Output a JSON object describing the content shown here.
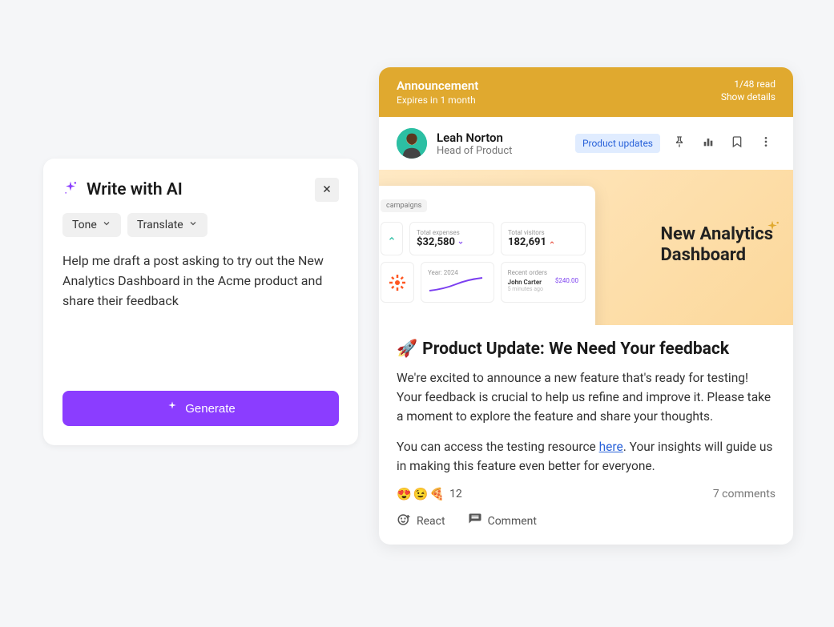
{
  "ai_panel": {
    "title": "Write with AI",
    "tone_label": "Tone",
    "translate_label": "Translate",
    "prompt": "Help me draft a post asking to try out the New Analytics Dashboard in the Acme product and share their feedback",
    "generate_label": "Generate"
  },
  "post": {
    "announcement": {
      "label": "Announcement",
      "expires": "Expires in 1 month",
      "read_status": "1/48 read",
      "show_details": "Show details"
    },
    "author": {
      "name": "Leah Norton",
      "role": "Head of Product"
    },
    "tag": "Product updates",
    "hero": {
      "title_line1": "New Analytics",
      "title_line2": "Dashboard",
      "dash_tab": "campaigns",
      "card1_label": "Total expenses",
      "card1_value": "$32,580",
      "card2_label": "Total visitors",
      "card2_value": "182,691",
      "year_label": "Year: 2024",
      "orders_label": "Recent orders",
      "order_name": "John Carter",
      "order_sub": "5 minutes ago",
      "order_price": "$240.00"
    },
    "title_emoji": "🚀",
    "title": "Product Update: We Need Your feedback",
    "para1": "We're excited to announce a new feature that's ready for testing! Your feedback is crucial to help us refine and improve it. Please take a moment to explore the feature and share your thoughts.",
    "para2_a": "You can access the testing resource ",
    "para2_link": "here",
    "para2_b": ". Your insights will guide us in making this feature even better for everyone.",
    "reactions": {
      "emojis": [
        "😍",
        "😉",
        "🍕"
      ],
      "count": "12"
    },
    "comments_count": "7 comments",
    "react_label": "React",
    "comment_label": "Comment"
  }
}
